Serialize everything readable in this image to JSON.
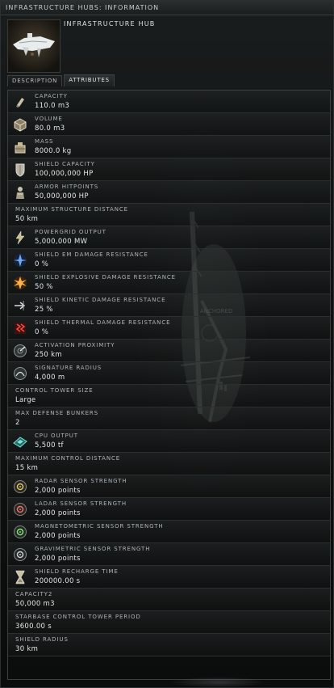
{
  "window": {
    "title": "INFRASTRUCTURE HUBS: INFORMATION"
  },
  "header": {
    "name": "INFRASTRUCTURE HUB"
  },
  "tabs": [
    {
      "label": "DESCRIPTION"
    },
    {
      "label": "ATTRIBUTES"
    }
  ],
  "attributes": [
    {
      "label": "CAPACITY",
      "value": "110.0 m3",
      "icon": "capacity-icon"
    },
    {
      "label": "VOLUME",
      "value": "80.0 m3",
      "icon": "volume-icon"
    },
    {
      "label": "MASS",
      "value": "8000.0 kg",
      "icon": "mass-icon"
    },
    {
      "label": "SHIELD CAPACITY",
      "value": "100,000,000 HP",
      "icon": "shield-icon"
    },
    {
      "label": "ARMOR HITPOINTS",
      "value": "50,000,000 HP",
      "icon": "armor-icon"
    },
    {
      "label": "MAXIMUM STRUCTURE DISTANCE",
      "value": "50 km",
      "icon": ""
    },
    {
      "label": "POWERGRID OUTPUT",
      "value": "5,000,000 MW",
      "icon": "powergrid-icon"
    },
    {
      "label": "SHIELD EM DAMAGE RESISTANCE",
      "value": "0 %",
      "icon": "em-resistance-icon"
    },
    {
      "label": "SHIELD EXPLOSIVE DAMAGE RESISTANCE",
      "value": "50 %",
      "icon": "explosive-resistance-icon"
    },
    {
      "label": "SHIELD KINETIC DAMAGE RESISTANCE",
      "value": "25 %",
      "icon": "kinetic-resistance-icon"
    },
    {
      "label": "SHIELD THERMAL DAMAGE RESISTANCE",
      "value": "0 %",
      "icon": "thermal-resistance-icon"
    },
    {
      "label": "ACTIVATION PROXIMITY",
      "value": "250 km",
      "icon": "proximity-icon"
    },
    {
      "label": "SIGNATURE RADIUS",
      "value": "4,000 m",
      "icon": "signature-icon"
    },
    {
      "label": "CONTROL TOWER SIZE",
      "value": "Large",
      "icon": ""
    },
    {
      "label": "MAX DEFENSE BUNKERS",
      "value": "2",
      "icon": ""
    },
    {
      "label": "CPU OUTPUT",
      "value": "5,500 tf",
      "icon": "cpu-icon"
    },
    {
      "label": "MAXIMUM CONTROL DISTANCE",
      "value": "15 km",
      "icon": ""
    },
    {
      "label": "RADAR SENSOR STRENGTH",
      "value": "2,000 points",
      "icon": "radar-sensor-icon"
    },
    {
      "label": "LADAR SENSOR STRENGTH",
      "value": "2,000 points",
      "icon": "ladar-sensor-icon"
    },
    {
      "label": "MAGNETOMETRIC SENSOR STRENGTH",
      "value": "2,000 points",
      "icon": "magnetometric-sensor-icon"
    },
    {
      "label": "GRAVIMETRIC SENSOR STRENGTH",
      "value": "2,000 points",
      "icon": "gravimetric-sensor-icon"
    },
    {
      "label": "SHIELD RECHARGE TIME",
      "value": "200000.00 s",
      "icon": "hourglass-icon"
    },
    {
      "label": "CAPACITY2",
      "value": "50,000 m3",
      "icon": ""
    },
    {
      "label": "STARBASE CONTROL TOWER PERIOD",
      "value": "3600.00 s",
      "icon": ""
    },
    {
      "label": "SHIELD RADIUS",
      "value": "30 km",
      "icon": ""
    }
  ],
  "colors": {
    "accent": "#3a3f3f",
    "label": "#aeb3b3",
    "value": "#e3e6e6"
  }
}
